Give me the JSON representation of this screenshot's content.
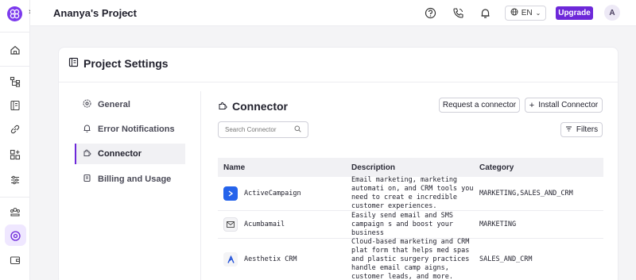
{
  "topbar": {
    "project_title": "Ananya's Project",
    "language": "EN",
    "upgrade_label": "Upgrade",
    "avatar_initial": "A"
  },
  "card": {
    "title": "Project Settings"
  },
  "nav": {
    "items": [
      {
        "label": "General",
        "icon": "gear-icon"
      },
      {
        "label": "Error Notifications",
        "icon": "bell-icon"
      },
      {
        "label": "Connector",
        "icon": "puzzle-icon",
        "active": true
      },
      {
        "label": "Billing and Usage",
        "icon": "receipt-icon"
      }
    ]
  },
  "connector": {
    "title": "Connector",
    "request_label": "Request a connector",
    "install_label": "Install Connector",
    "filters_label": "Filters",
    "search_placeholder": "Search Connector"
  },
  "table": {
    "headers": [
      "Name",
      "Description",
      "Category"
    ],
    "rows": [
      {
        "name": "ActiveCampaign",
        "description": "Email marketing, marketing automati on, and CRM tools you need to creat e incredible customer experiences.",
        "category": "MARKETING,SALES_AND_CRM"
      },
      {
        "name": "Acumbamail",
        "description": "Easily send email and SMS campaign s and boost your business",
        "category": "MARKETING"
      },
      {
        "name": "Aesthetix CRM",
        "description": "Cloud-based marketing and CRM plat form that helps med spas and plastic surgery practices handle email camp aigns, customer leads, and more.",
        "category": "SALES_AND_CRM"
      }
    ]
  },
  "colors": {
    "accent": "#6d28d9",
    "brand": "#7c3aed"
  }
}
